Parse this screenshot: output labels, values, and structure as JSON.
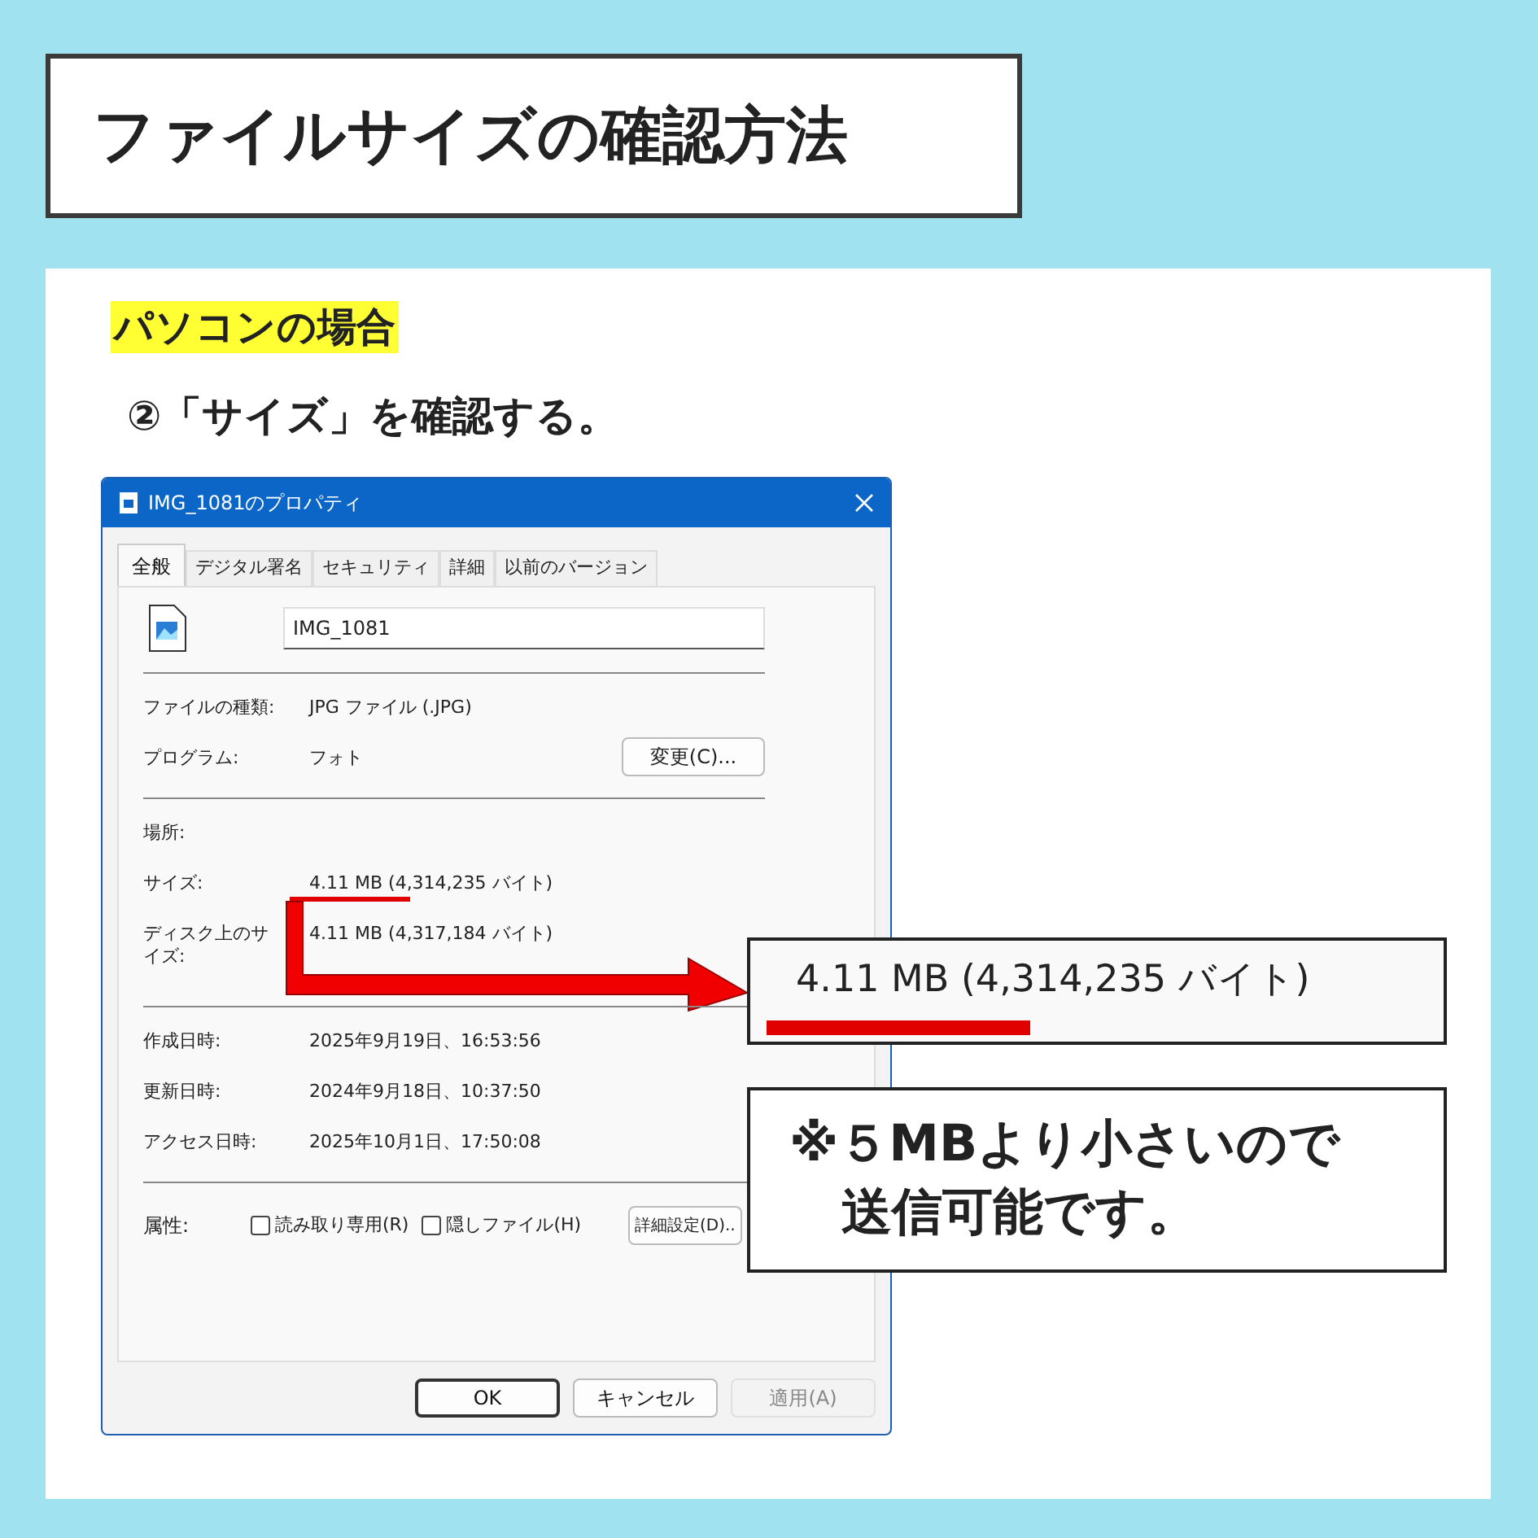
{
  "title": "ファイルサイズの確認方法",
  "section": "パソコンの場合",
  "step": "②「サイズ」を確認する。",
  "dialog": {
    "title": "IMG_1081のプロパティ",
    "tabs": [
      {
        "label": "全般",
        "selected": true
      },
      {
        "label": "デジタル署名",
        "selected": false
      },
      {
        "label": "セキュリティ",
        "selected": false
      },
      {
        "label": "詳細",
        "selected": false
      },
      {
        "label": "以前のバージョン",
        "selected": false
      }
    ],
    "file_name": "IMG_1081",
    "sections": [
      {
        "rows": [
          {
            "label": "ファイルの種類:",
            "value": "JPG ファイル (.JPG)"
          },
          {
            "label": "プログラム:",
            "value": "フォト",
            "button": "変更(C)..."
          }
        ]
      },
      {
        "rows": [
          {
            "label": "場所:"
          },
          {
            "label": "サイズ:",
            "value": "4.11 MB (4,314,235 バイト)",
            "underlined": true
          },
          {
            "label": "ディスク上のサイズ:",
            "value": "4.11 MB (4,317,184 バイト)"
          }
        ]
      },
      {
        "rows": [
          {
            "label": "作成日時:",
            "value": "2025年9月19日、16:53:56"
          },
          {
            "label": "更新日時:",
            "value": "2024年9月18日、10:37:50"
          },
          {
            "label": "アクセス日時:",
            "value": "2025年10月1日、17:50:08"
          }
        ]
      }
    ],
    "attributes": {
      "label": "属性:",
      "checkboxes": [
        {
          "label": "読み取り専用(R)",
          "checked": false
        },
        {
          "label": "隠しファイル(H)",
          "checked": false
        }
      ],
      "button": "詳細設定(D).."
    },
    "buttons": [
      {
        "label": "OK",
        "default": true,
        "disabled": false
      },
      {
        "label": "キャンセル",
        "default": false,
        "disabled": false
      },
      {
        "label": "適用(A)",
        "default": false,
        "disabled": true
      }
    ]
  },
  "zoom_callout": {
    "text": "4.11 MB (4,314,235 バイト)",
    "underlined": true
  },
  "note": {
    "lines": [
      "※５MBより小さいので",
      "送信可能です。"
    ]
  }
}
